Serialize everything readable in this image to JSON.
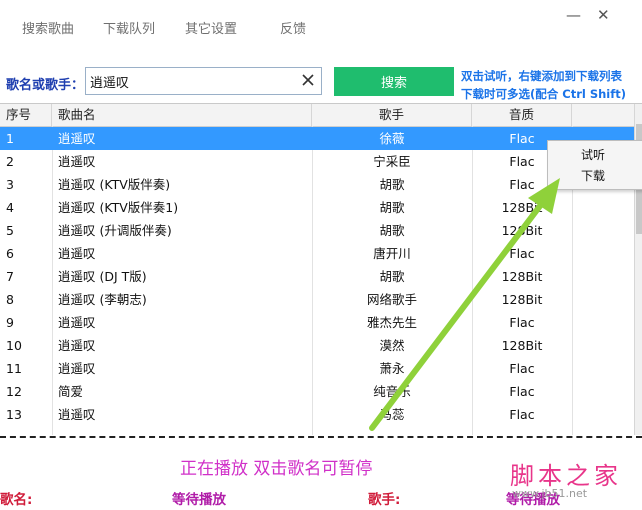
{
  "menu": {
    "items": [
      "搜索歌曲",
      "下载队列",
      "其它设置",
      "反馈"
    ]
  },
  "window": {
    "minimize": "—",
    "close": "✕"
  },
  "search": {
    "label": "歌名或歌手：",
    "value": "逍遥叹",
    "button": "搜索",
    "hint_line1": "双击试听，右键添加到下载列表",
    "hint_line2": "下载时可多选(配合 Ctrl Shift)"
  },
  "table": {
    "headers": [
      "序号",
      "歌曲名",
      "歌手",
      "音质"
    ],
    "rows": [
      {
        "index": "1",
        "name": "逍遥叹",
        "artist": "徐薇",
        "quality": "Flac"
      },
      {
        "index": "2",
        "name": "逍遥叹",
        "artist": "宁采臣",
        "quality": "Flac"
      },
      {
        "index": "3",
        "name": "逍遥叹 (KTV版伴奏)",
        "artist": "胡歌",
        "quality": "Flac"
      },
      {
        "index": "4",
        "name": "逍遥叹 (KTV版伴奏1)",
        "artist": "胡歌",
        "quality": "128Bit"
      },
      {
        "index": "5",
        "name": "逍遥叹 (升调版伴奏)",
        "artist": "胡歌",
        "quality": "128Bit"
      },
      {
        "index": "6",
        "name": "逍遥叹",
        "artist": "唐开川",
        "quality": "Flac"
      },
      {
        "index": "7",
        "name": "逍遥叹 (DJ T版)",
        "artist": "胡歌",
        "quality": "128Bit"
      },
      {
        "index": "8",
        "name": "逍遥叹 (李朝志)",
        "artist": "网络歌手",
        "quality": "128Bit"
      },
      {
        "index": "9",
        "name": "逍遥叹",
        "artist": "雅杰先生",
        "quality": "Flac"
      },
      {
        "index": "10",
        "name": "逍遥叹",
        "artist": "漠然",
        "quality": "128Bit"
      },
      {
        "index": "11",
        "name": "逍遥叹",
        "artist": "萧永",
        "quality": "Flac"
      },
      {
        "index": "12",
        "name": "简爱",
        "artist": "纯音乐",
        "quality": "Flac"
      },
      {
        "index": "13",
        "name": "逍遥叹",
        "artist": "马蕊",
        "quality": "Flac"
      }
    ]
  },
  "context_menu": {
    "items": [
      "试听",
      "下载"
    ]
  },
  "player": {
    "now_playing": "正在播放    双击歌名可暂停",
    "song_label": "歌名:",
    "song_value": "等待播放",
    "artist_label": "歌手:",
    "artist_value": "等待播放"
  },
  "watermark": {
    "logo": "脚本之家",
    "url": "www.jb51.net"
  },
  "colors": {
    "accent_green": "#1fbd6e",
    "selection_blue": "#3399ff",
    "arrow_green": "#8fd13a",
    "magenta": "#d030c8"
  }
}
